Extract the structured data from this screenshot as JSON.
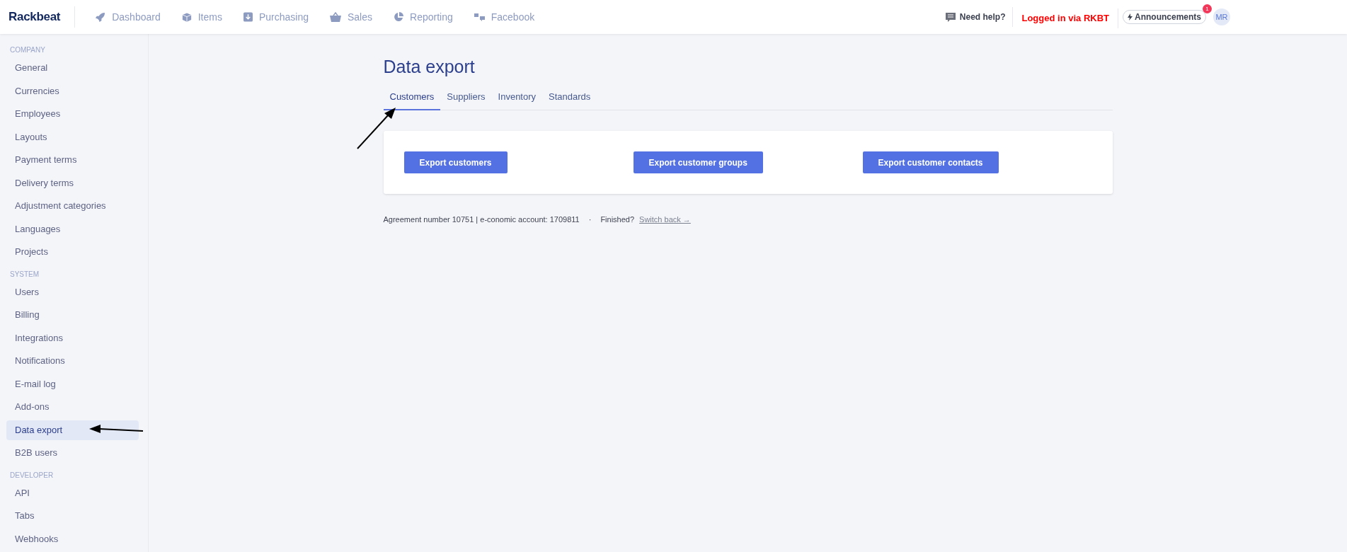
{
  "brand": "Rackbeat",
  "nav": [
    {
      "label": "Dashboard",
      "kind": "rocket"
    },
    {
      "label": "Items",
      "kind": "box"
    },
    {
      "label": "Purchasing",
      "kind": "download"
    },
    {
      "label": "Sales",
      "kind": "basket"
    },
    {
      "label": "Reporting",
      "kind": "pie"
    },
    {
      "label": "Facebook",
      "kind": "chat"
    }
  ],
  "help": "Need help?",
  "login_notice": "Logged in via RKBT",
  "announcements": {
    "label": "Announcements",
    "badge": "1"
  },
  "avatar": "MR",
  "sidebar": [
    {
      "heading": "COMPANY",
      "items": [
        {
          "label": "General",
          "selected": false
        },
        {
          "label": "Currencies",
          "selected": false
        },
        {
          "label": "Employees",
          "selected": false
        },
        {
          "label": "Layouts",
          "selected": false
        },
        {
          "label": "Payment terms",
          "selected": false
        },
        {
          "label": "Delivery terms",
          "selected": false
        },
        {
          "label": "Adjustment categories",
          "selected": false
        },
        {
          "label": "Languages",
          "selected": false
        },
        {
          "label": "Projects",
          "selected": false
        }
      ]
    },
    {
      "heading": "SYSTEM",
      "items": [
        {
          "label": "Users",
          "selected": false
        },
        {
          "label": "Billing",
          "selected": false
        },
        {
          "label": "Integrations",
          "selected": false
        },
        {
          "label": "Notifications",
          "selected": false
        },
        {
          "label": "E-mail log",
          "selected": false
        },
        {
          "label": "Add-ons",
          "selected": false
        },
        {
          "label": "Data export",
          "selected": true
        },
        {
          "label": "B2B users",
          "selected": false
        }
      ]
    },
    {
      "heading": "DEVELOPER",
      "items": [
        {
          "label": "API",
          "selected": false
        },
        {
          "label": "Tabs",
          "selected": false
        },
        {
          "label": "Webhooks",
          "selected": false
        }
      ]
    }
  ],
  "page_title": "Data export",
  "tabs": [
    {
      "label": "Customers",
      "selected": true
    },
    {
      "label": "Suppliers",
      "selected": false
    },
    {
      "label": "Inventory",
      "selected": false
    },
    {
      "label": "Standards",
      "selected": false
    }
  ],
  "buttons": [
    "Export customers",
    "Export customer groups",
    "Export customer contacts"
  ],
  "footer": {
    "account": "Agreement number 10751 | e-conomic account: 1709811",
    "separator": "·",
    "finished": "Finished?",
    "link": "Switch back →"
  }
}
